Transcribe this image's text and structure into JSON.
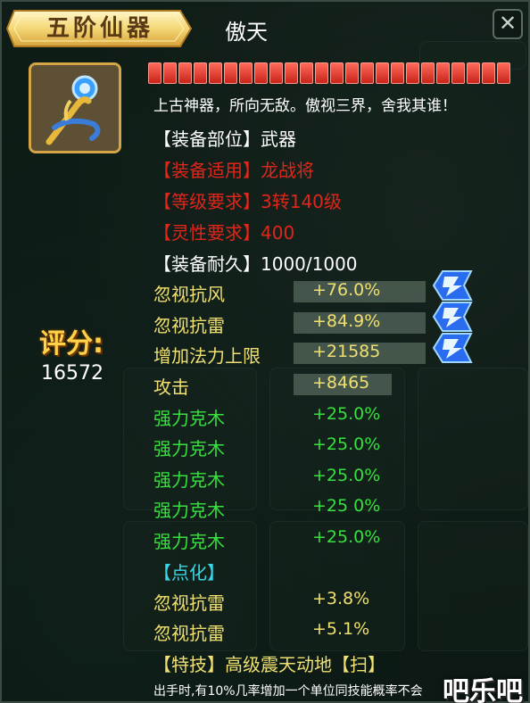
{
  "header": {
    "tier_label": "五阶仙器",
    "item_name": "傲天",
    "close_symbol": "✕"
  },
  "item": {
    "description": "上古神器，所向无敌。傲视三界，舍我其谁！",
    "durability_segments": 24,
    "equip_slot": "【装备部位】武器",
    "equip_for_label": "【装备适用】",
    "equip_for_value": "龙战将",
    "level_req_label": "【等级要求】",
    "level_req_value": "3转140级",
    "spirit_req_label": "【灵性要求】",
    "spirit_req_value": "400",
    "durability_label": "【装备耐久】",
    "durability_value": "1000/1000"
  },
  "score": {
    "label": "评分:",
    "value": "16572"
  },
  "base_stats": [
    {
      "name": "忽视抗风",
      "value": "+76.0%",
      "badge": true
    },
    {
      "name": "忽视抗雷",
      "value": "+84.9%",
      "badge": true
    },
    {
      "name": "增加法力上限",
      "value": "+21585",
      "badge": true
    },
    {
      "name": "攻击",
      "value": "+8465",
      "badge": false
    }
  ],
  "bonus_stats": [
    {
      "name": "强力克木",
      "value": "+25.0%"
    },
    {
      "name": "强力克木",
      "value": "+25.0%"
    },
    {
      "name": "强力克木",
      "value": "+25.0%"
    },
    {
      "name": "强力克木",
      "value": "+25 0%"
    },
    {
      "name": "强力克木",
      "value": "+25.0%"
    }
  ],
  "refine": {
    "header": "【点化】",
    "stats": [
      {
        "name": "忽视抗雷",
        "value": "+3.8%"
      },
      {
        "name": "忽视抗雷",
        "value": "+5.1%"
      }
    ]
  },
  "skill": {
    "header": "【特技】高级震天动地【扫】",
    "desc": "出手时,有10%几率增加一个单位同技能概率不会"
  },
  "watermark": "吧乐吧",
  "colors": {
    "red": "#e0261a",
    "yellow": "#f0e070",
    "green": "#38e040",
    "cyan": "#38d8e8",
    "gold": "#ffd24a"
  }
}
